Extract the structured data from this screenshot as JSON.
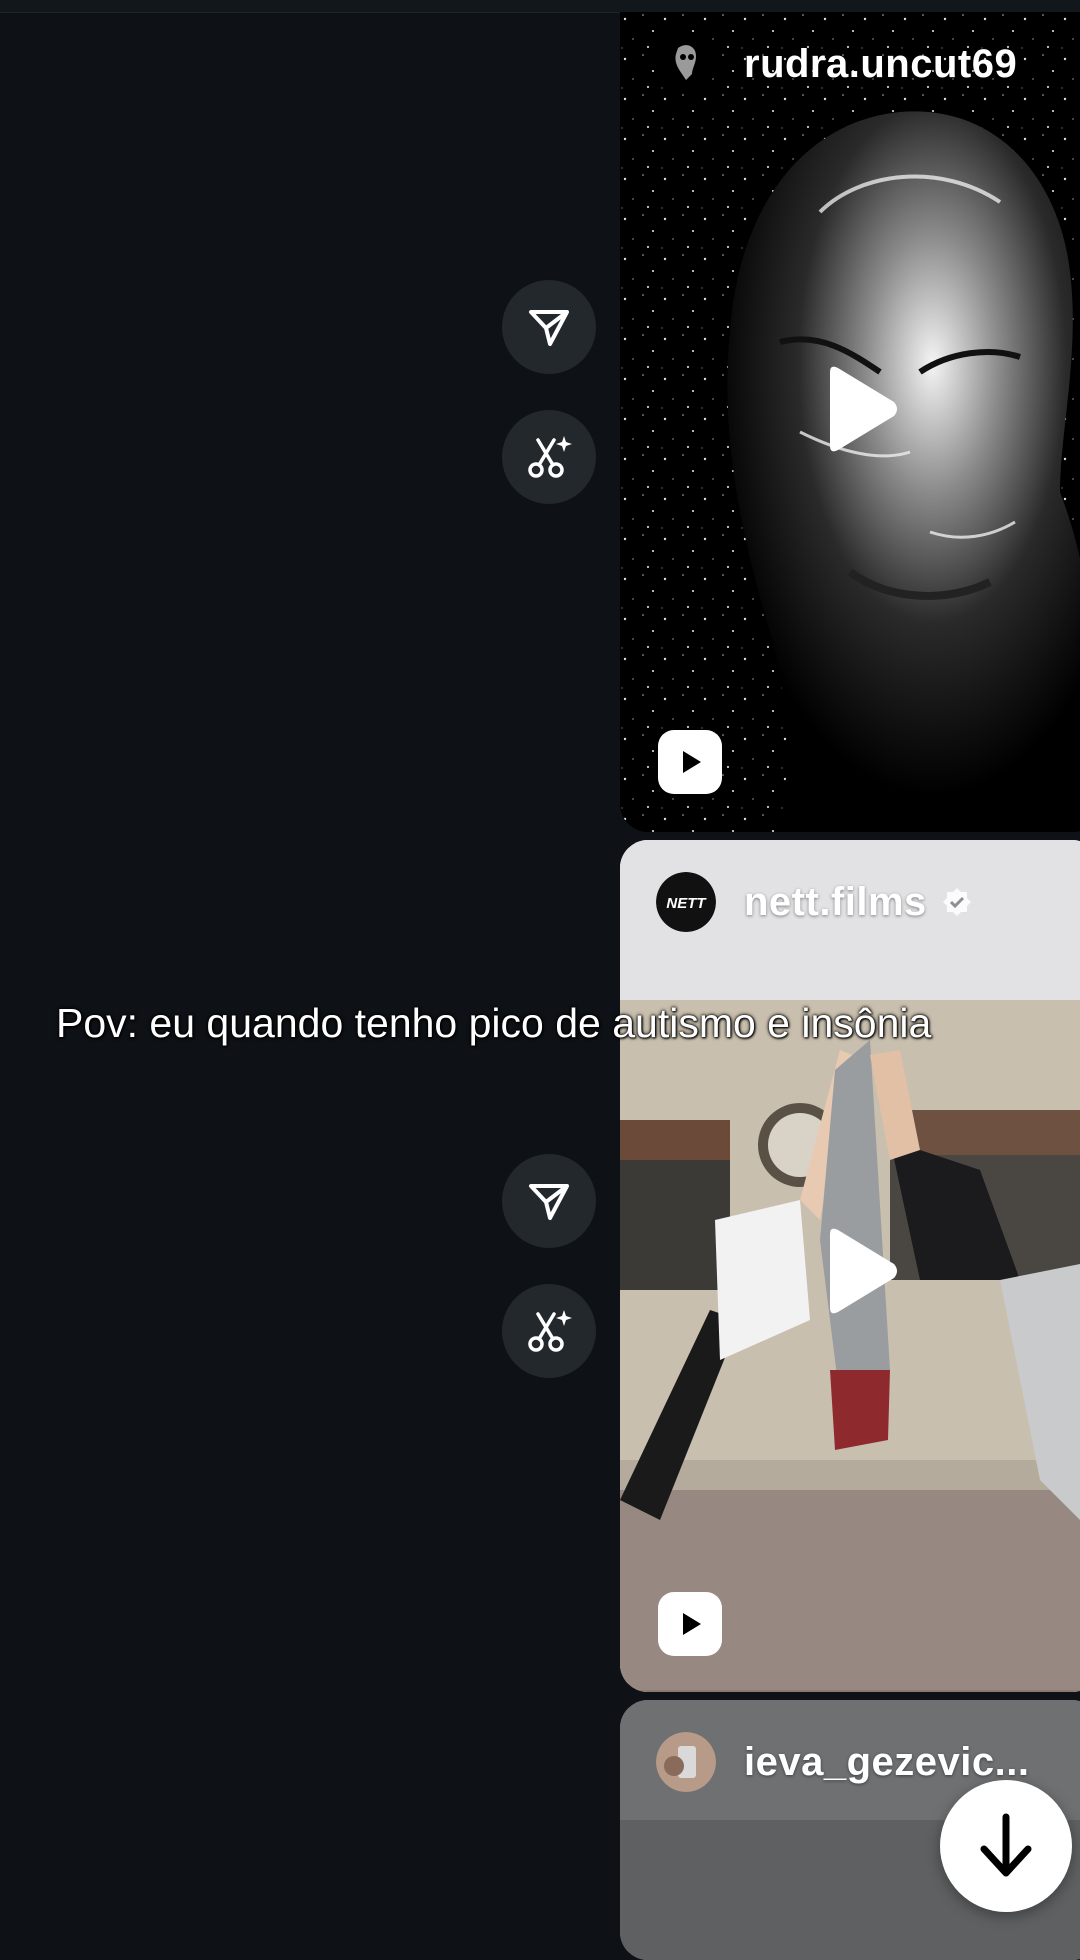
{
  "feed": {
    "posts": [
      {
        "username": "rudra.uncut69",
        "avatar_icon": "skull-avatar-icon",
        "type": "reel"
      },
      {
        "username": "nett.films",
        "verified": true,
        "avatar_label": "NETT",
        "type": "reel"
      },
      {
        "username": "ieva_gezevic...",
        "avatar_icon": "photo-avatar",
        "type": "reel"
      }
    ]
  },
  "overlay": {
    "caption": "Pov: eu quando tenho pico de autismo e insônia"
  },
  "actions": {
    "share_icon": "send-icon",
    "remix_icon": "remix-sparkle-icon"
  },
  "controls": {
    "scroll_icon": "arrow-down-icon"
  },
  "colors": {
    "background": "#0e1216",
    "button_bg": "#23282d",
    "text": "#ffffff"
  }
}
